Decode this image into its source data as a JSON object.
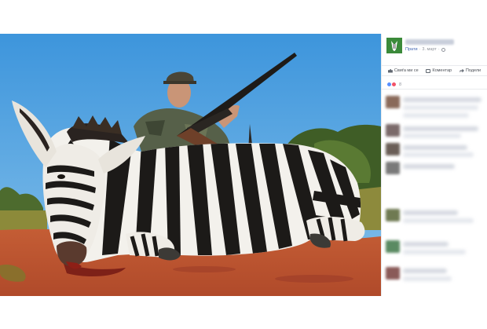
{
  "post": {
    "author_name": "",
    "follow_label": "Прати",
    "separator": "·",
    "date": "3. март",
    "privacy_icon": "globe-icon"
  },
  "actions": {
    "like_label": "Свиѓа ми се",
    "comment_label": "Коментар",
    "share_label": "Подели"
  },
  "reactions": {
    "count": "8",
    "types": [
      "like",
      "haha"
    ]
  },
  "colors": {
    "link": "#4267b2",
    "meta": "#90949c",
    "divider": "#e9ebee",
    "like_blue": "#5890ff",
    "haha_red": "#f25268",
    "sky": "#4fa3e0",
    "sand": "#c9573a"
  },
  "photo": {
    "subject": "hunter-with-rifle-and-zebra"
  },
  "comments": [
    {
      "avatar_color": "#8a6a5a"
    },
    {
      "avatar_color": "#7b6a6a"
    },
    {
      "avatar_color": "#6a5e57"
    },
    {
      "avatar_color": "#7a7a7a"
    },
    {
      "avatar_color": "#6f7a52"
    },
    {
      "avatar_color": "#5a8a62"
    },
    {
      "avatar_color": "#8a5a58"
    }
  ]
}
